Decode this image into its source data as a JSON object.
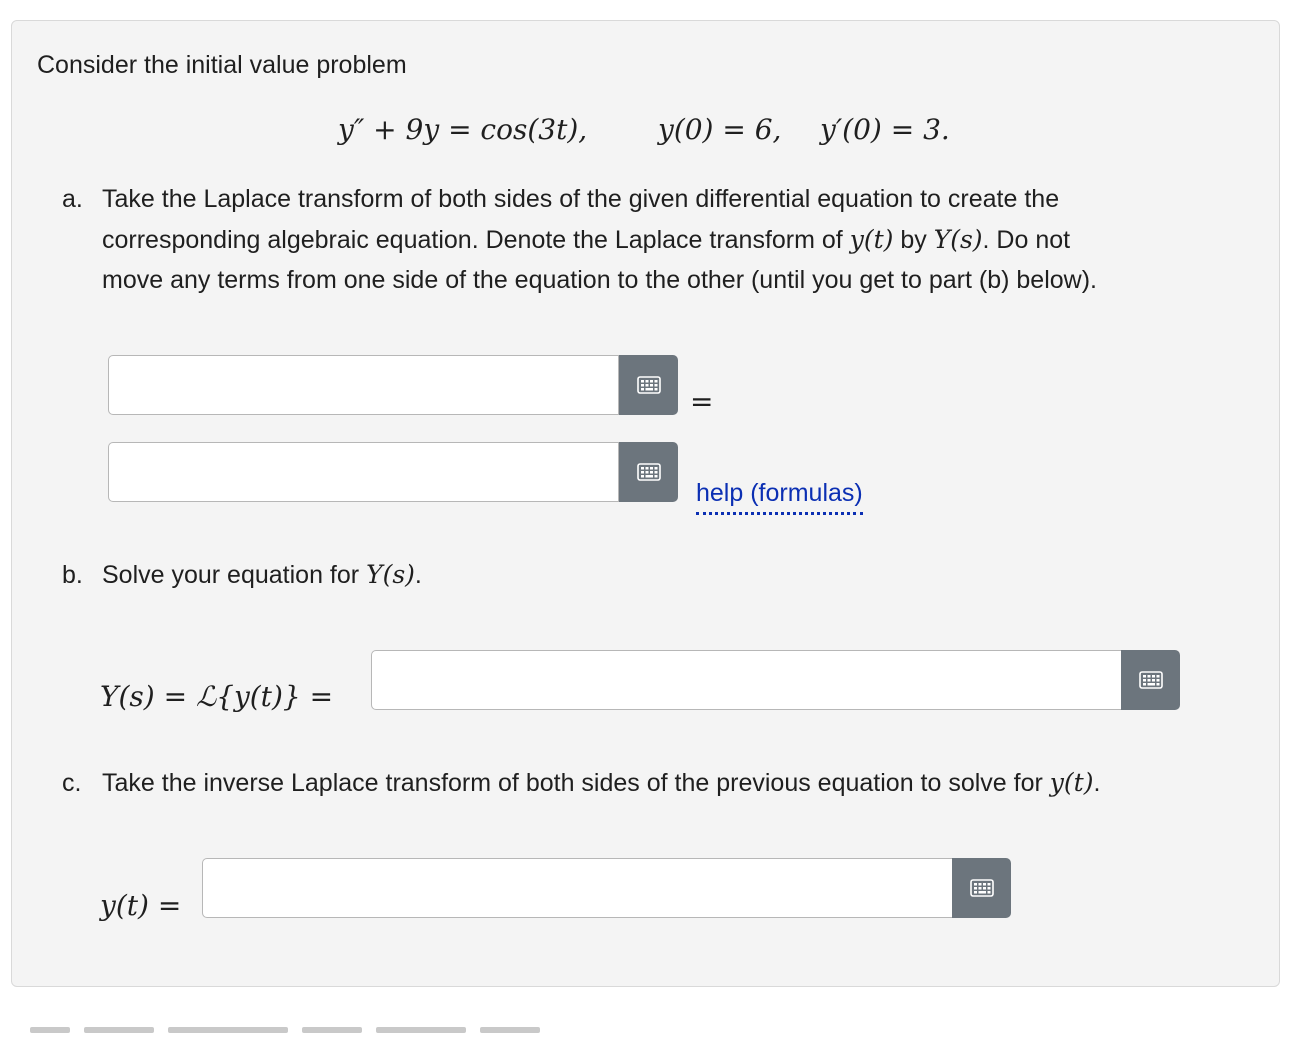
{
  "problem": {
    "intro": "Consider the initial value problem",
    "ode": "y″ + 9y = cos(3t),",
    "ic1": "y(0) = 6,",
    "ic2": "y′(0) = 3."
  },
  "part_a": {
    "marker": "a.",
    "line1": "Take the Laplace transform of both sides of the given differential equation to create the",
    "line2_pre": "corresponding algebraic equation. Denote the Laplace transform of ",
    "line2_y": "y(t)",
    "line2_by": " by ",
    "line2_Y": "Y(s)",
    "line2_post": ". Do not",
    "line3": "move any terms from one side of the equation to the other (until you get to part (b) below).",
    "equals": "=",
    "help_link": "help (formulas)"
  },
  "part_b": {
    "marker": "b.",
    "text": "Solve your equation for ",
    "Y": "Y(s)",
    "period": ".",
    "lhs": "Y(s) = ℒ{y(t)} ="
  },
  "part_c": {
    "marker": "c.",
    "text": "Take the inverse Laplace transform of both sides of the previous equation to solve for ",
    "y": "y(t)",
    "period": ".",
    "lhs": "y(t) ="
  },
  "icons": {
    "keyboard": "keyboard-icon",
    "button_color": "#6c757d",
    "link_color": "#0b2fb3"
  }
}
